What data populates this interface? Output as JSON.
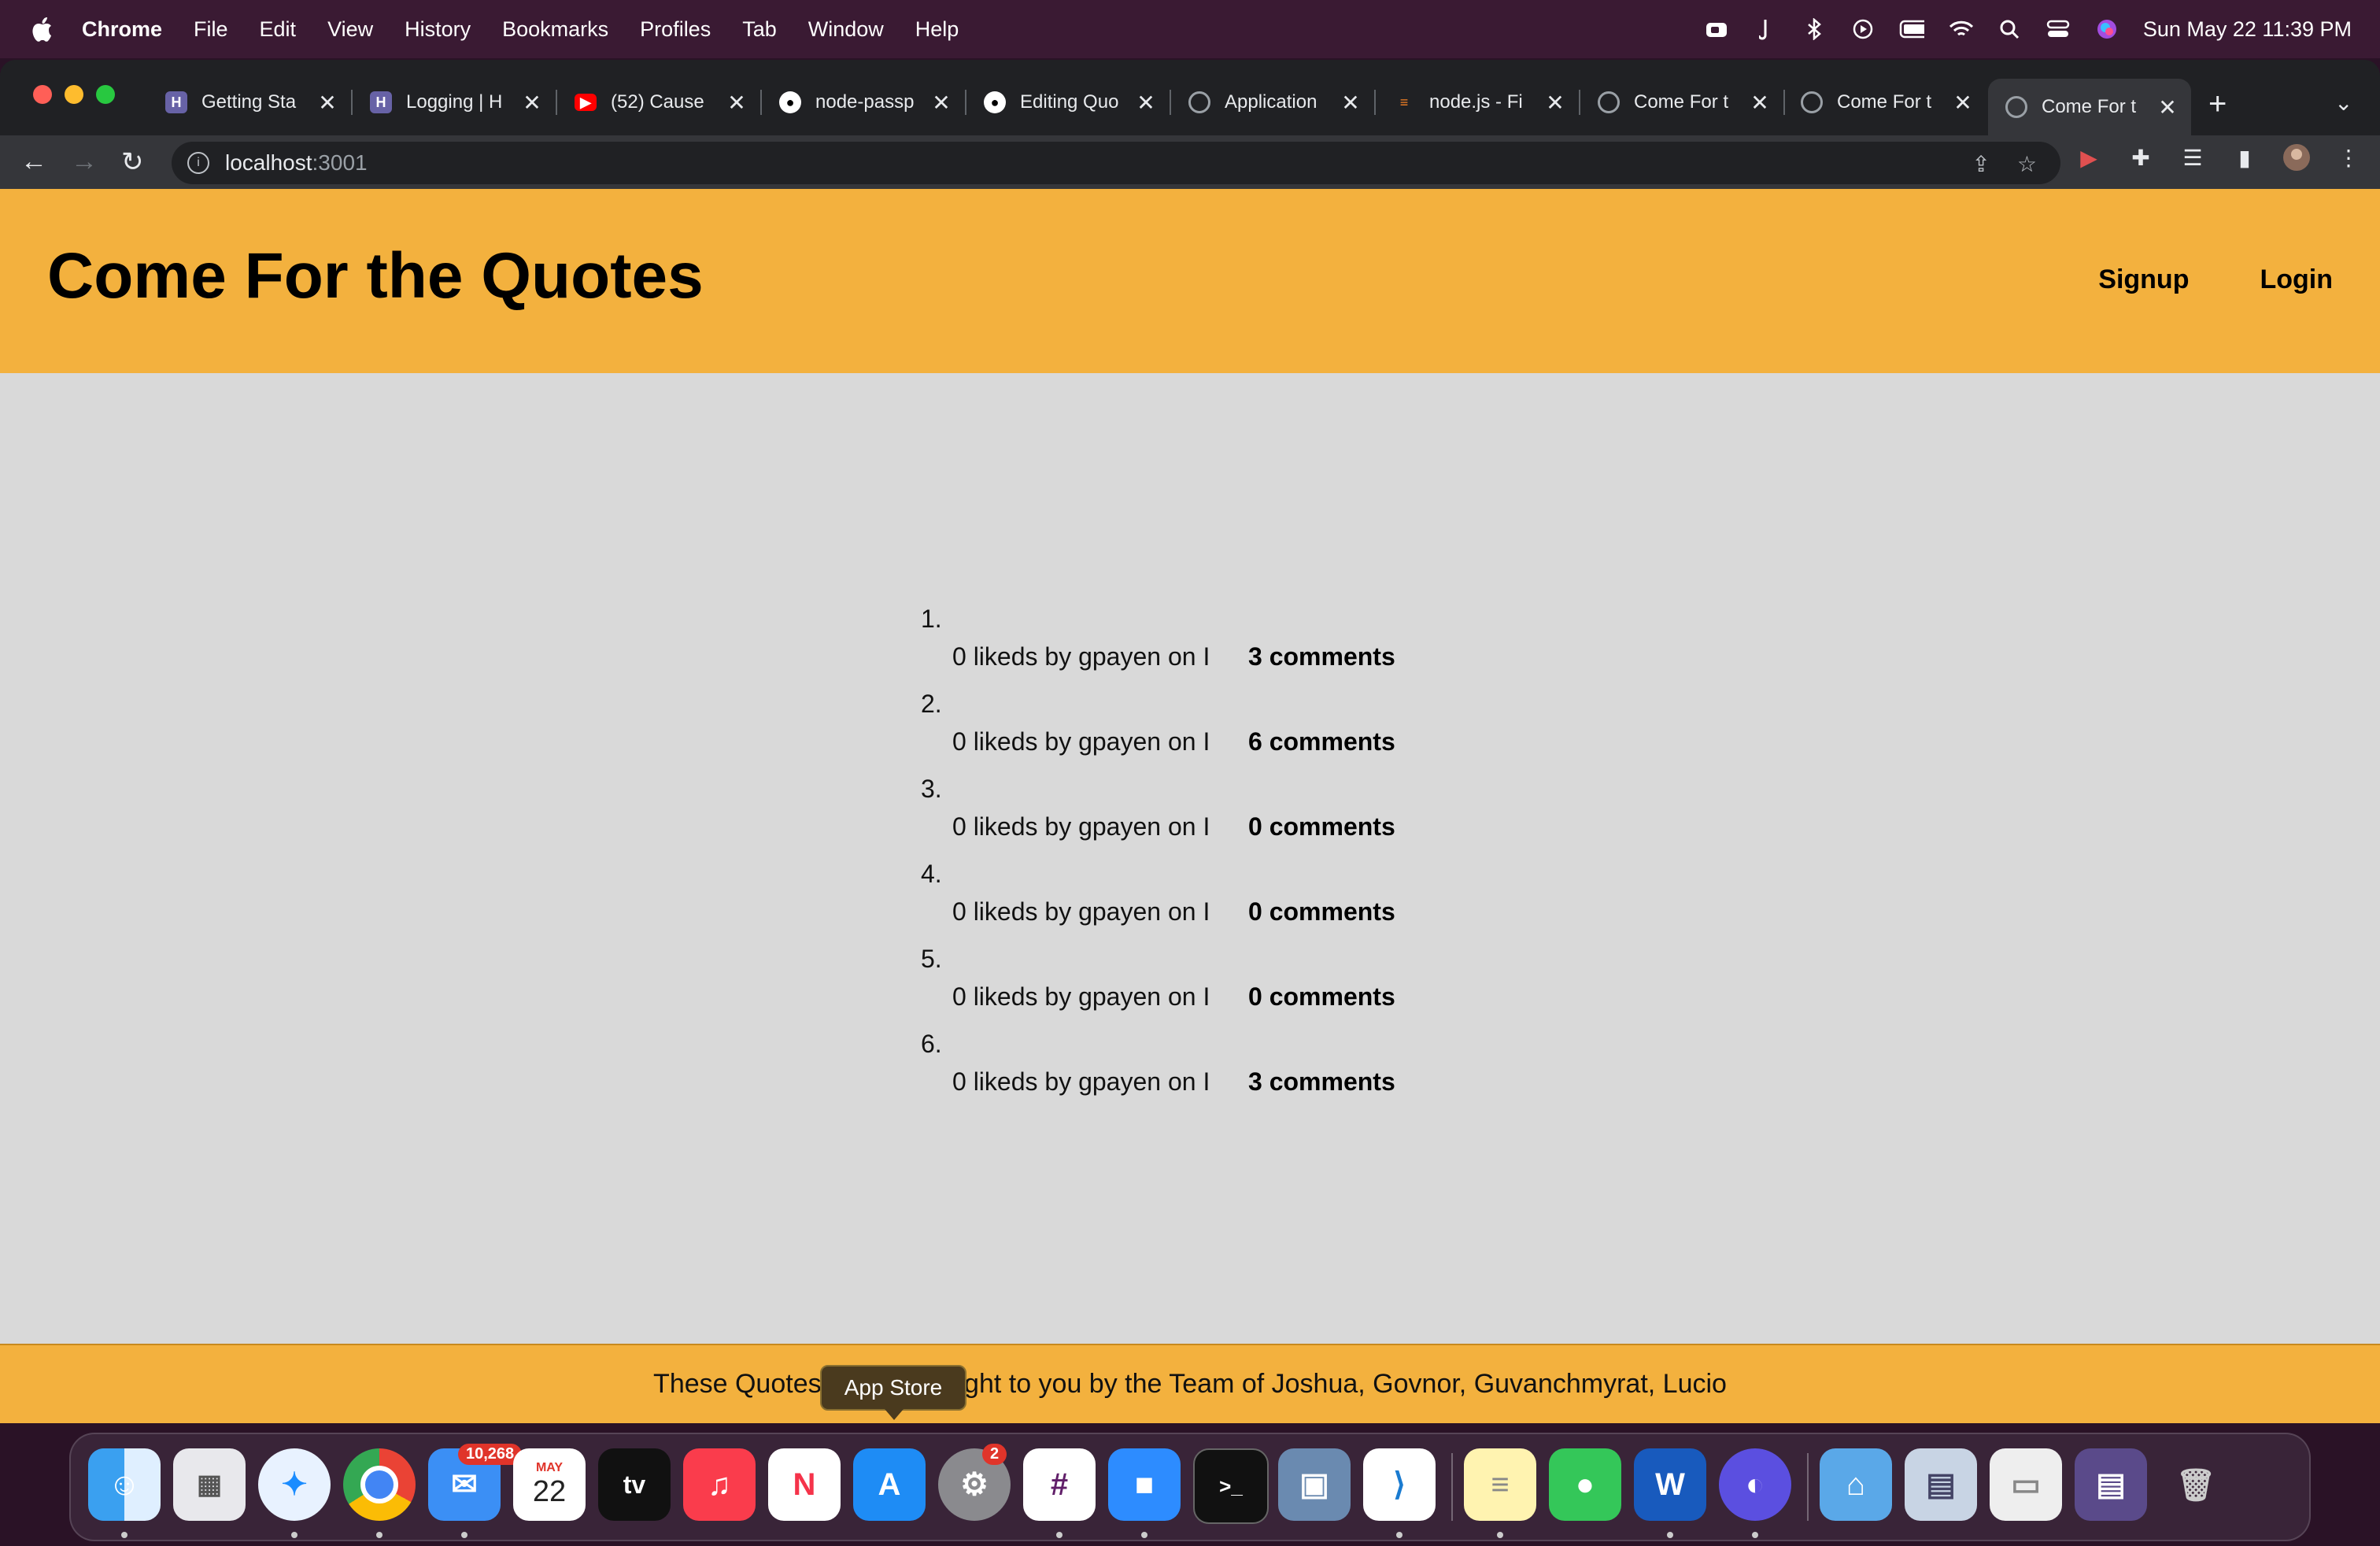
{
  "menubar": {
    "app_name": "Chrome",
    "menus": [
      "File",
      "Edit",
      "View",
      "History",
      "Bookmarks",
      "Profiles",
      "Tab",
      "Window",
      "Help"
    ],
    "datetime": "Sun May 22  11:39 PM"
  },
  "browser": {
    "tabs": [
      {
        "title": "Getting Sta",
        "icon": "heroku-icon",
        "color": "#6762a6"
      },
      {
        "title": "Logging | H",
        "icon": "heroku-icon",
        "color": "#6762a6"
      },
      {
        "title": "(52) Cause",
        "icon": "youtube-icon",
        "color": "#ff0000"
      },
      {
        "title": "node-passp",
        "icon": "github-icon",
        "color": "#ffffff"
      },
      {
        "title": "Editing Quo",
        "icon": "github-icon",
        "color": "#ffffff"
      },
      {
        "title": "Application",
        "icon": "globe-icon",
        "color": "#9aa0a6"
      },
      {
        "title": "node.js - Fi",
        "icon": "stackoverflow-icon",
        "color": "#f48024"
      },
      {
        "title": "Come For t",
        "icon": "globe-icon",
        "color": "#9aa0a6"
      },
      {
        "title": "Come For t",
        "icon": "globe-icon",
        "color": "#9aa0a6"
      },
      {
        "title": "Come For t",
        "icon": "globe-icon",
        "color": "#9aa0a6"
      }
    ],
    "active_tab": 9,
    "url_host": "localhost",
    "url_port": ":3001"
  },
  "site": {
    "title": "Come For the Quotes",
    "nav": {
      "signup": "Signup",
      "login": "Login"
    },
    "quotes": [
      {
        "num": "1.",
        "meta": "0 likeds by gpayen on I",
        "comments": "3 comments"
      },
      {
        "num": "2.",
        "meta": "0 likeds by gpayen on I",
        "comments": "6 comments"
      },
      {
        "num": "3.",
        "meta": "0 likeds by gpayen on I",
        "comments": "0 comments"
      },
      {
        "num": "4.",
        "meta": "0 likeds by gpayen on I",
        "comments": "0 comments"
      },
      {
        "num": "5.",
        "meta": "0 likeds by gpayen on I",
        "comments": "0 comments"
      },
      {
        "num": "6.",
        "meta": "0 likeds by gpayen on I",
        "comments": "3 comments"
      }
    ],
    "footer": "These Quotes will be brought to you by the Team of Joshua, Govnor, Guvanchmyrat, Lucio",
    "header_color": "#f3b13e",
    "body_color": "#d9d9d9"
  },
  "tooltip": "App Store",
  "dock": {
    "mail_badge": "10,268",
    "calendar_month": "MAY",
    "calendar_day": "22",
    "settings_badge": "2",
    "tv_label": "tv"
  }
}
